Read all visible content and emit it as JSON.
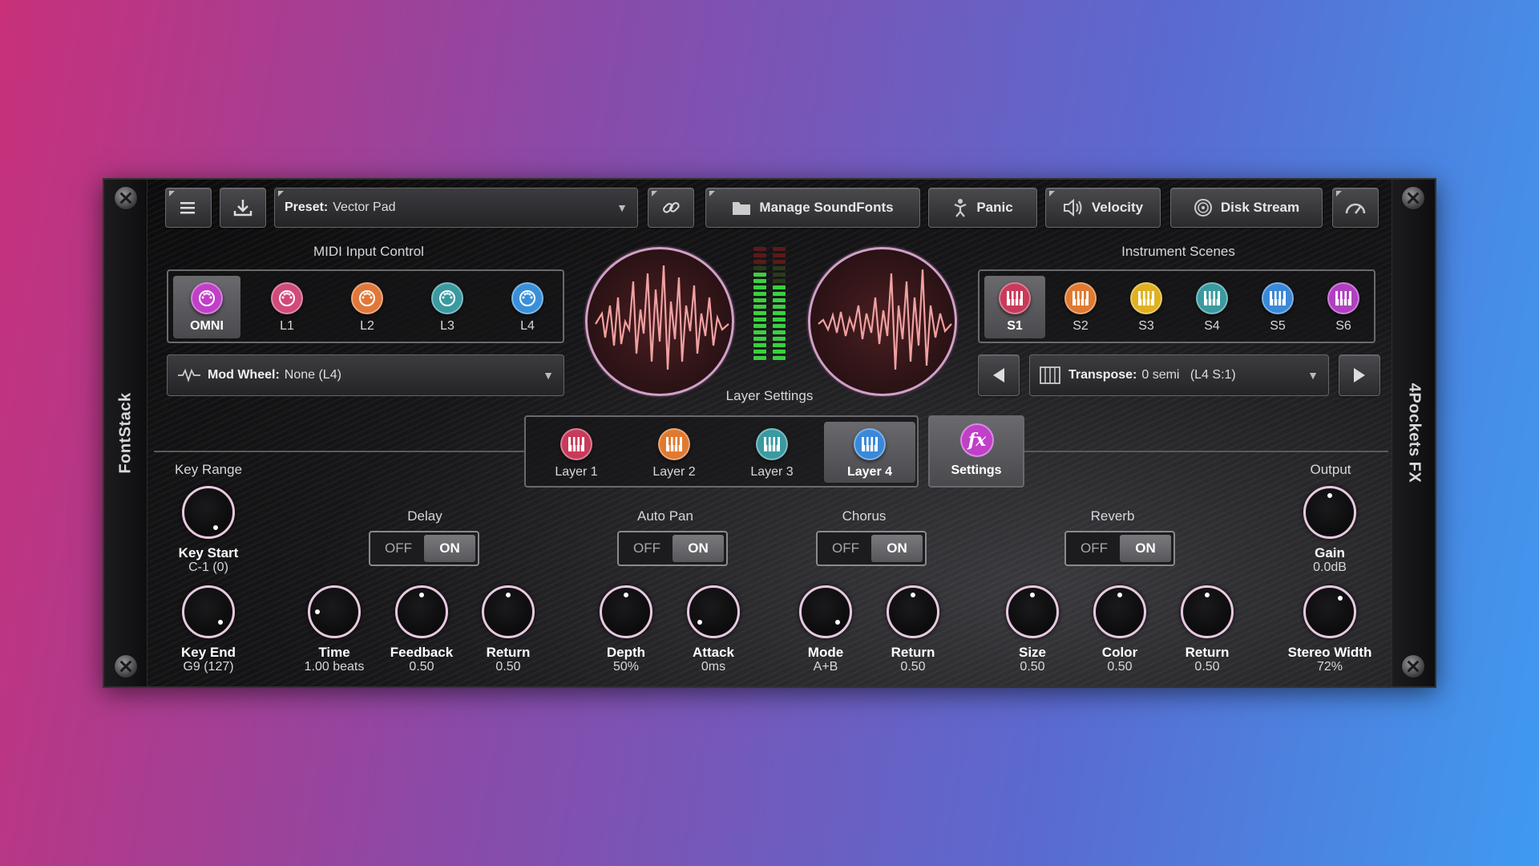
{
  "side": {
    "left": "FontStack",
    "right": "4Pockets FX"
  },
  "toolbar": {
    "preset_label": "Preset:",
    "preset_value": "Vector Pad",
    "manage_soundfonts": "Manage SoundFonts",
    "panic": "Panic",
    "velocity": "Velocity",
    "disk_stream": "Disk Stream"
  },
  "midi": {
    "title": "MIDI Input Control",
    "items": [
      {
        "label": "OMNI",
        "color": "#c040c8"
      },
      {
        "label": "L1",
        "color": "#d04a7a"
      },
      {
        "label": "L2",
        "color": "#e0783a"
      },
      {
        "label": "L3",
        "color": "#3a9aa0"
      },
      {
        "label": "L4",
        "color": "#3a90d8"
      }
    ],
    "mod_label": "Mod Wheel:",
    "mod_value": "None (L4)"
  },
  "scenes": {
    "title": "Instrument Scenes",
    "items": [
      {
        "label": "S1",
        "color": "#c83a5a"
      },
      {
        "label": "S2",
        "color": "#e07a30"
      },
      {
        "label": "S3",
        "color": "#e0b020"
      },
      {
        "label": "S4",
        "color": "#3a9aa0"
      },
      {
        "label": "S5",
        "color": "#3a88d8"
      },
      {
        "label": "S6",
        "color": "#b040c0"
      }
    ],
    "transpose_label": "Transpose:",
    "transpose_value": "0 semi   (L4 S:1)"
  },
  "layers": {
    "title": "Layer Settings",
    "items": [
      {
        "label": "Layer 1",
        "color": "#c83a5a"
      },
      {
        "label": "Layer 2",
        "color": "#e07a30"
      },
      {
        "label": "Layer 3",
        "color": "#3a9aa0"
      },
      {
        "label": "Layer 4",
        "color": "#3a88d8"
      }
    ],
    "settings": "Settings",
    "fx": "fx"
  },
  "keyrange": {
    "title": "Key Range",
    "start_name": "Key Start",
    "start_value": "C-1 (0)",
    "end_name": "Key End",
    "end_value": "G9 (127)"
  },
  "output": {
    "title": "Output",
    "gain_name": "Gain",
    "gain_value": "0.0dB",
    "width_name": "Stereo Width",
    "width_value": "72%"
  },
  "toggle": {
    "off": "OFF",
    "on": "ON"
  },
  "delay": {
    "title": "Delay",
    "time_name": "Time",
    "time_value": "1.00 beats",
    "feedback_name": "Feedback",
    "feedback_value": "0.50",
    "return_name": "Return",
    "return_value": "0.50"
  },
  "autopan": {
    "title": "Auto Pan",
    "depth_name": "Depth",
    "depth_value": "50%",
    "attack_name": "Attack",
    "attack_value": "0ms"
  },
  "chorus": {
    "title": "Chorus",
    "mode_name": "Mode",
    "mode_value": "A+B",
    "return_name": "Return",
    "return_value": "0.50"
  },
  "reverb": {
    "title": "Reverb",
    "size_name": "Size",
    "size_value": "0.50",
    "color_name": "Color",
    "color_value": "0.50",
    "return_name": "Return",
    "return_value": "0.50"
  }
}
